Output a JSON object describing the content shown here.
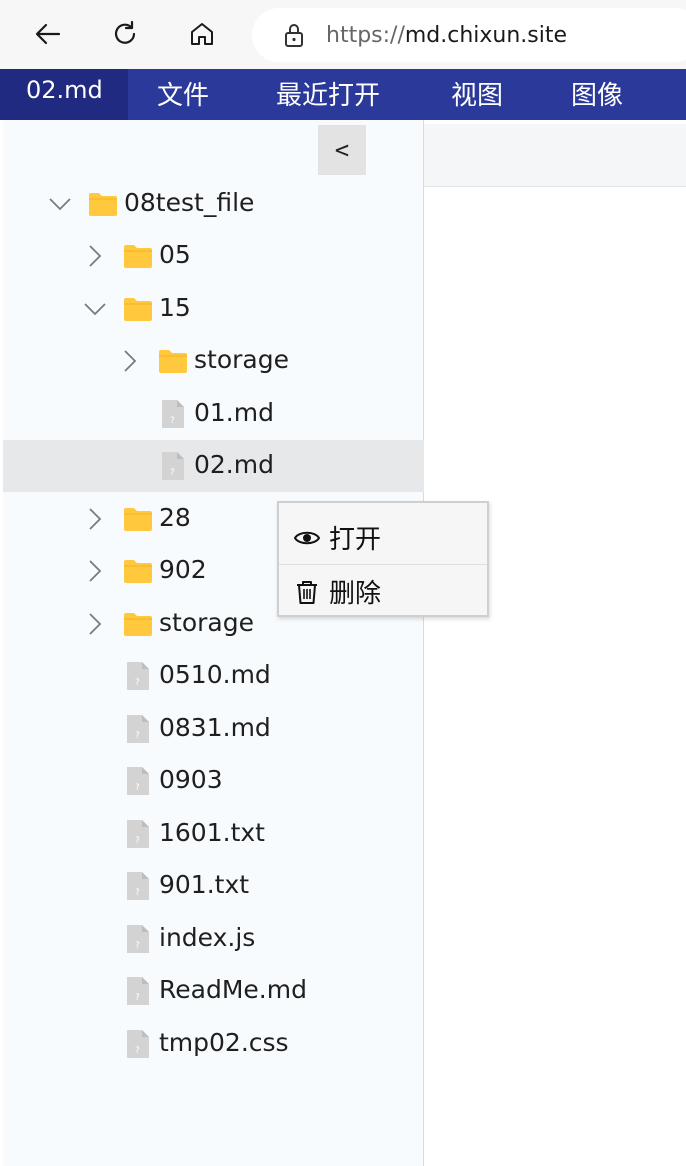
{
  "browser": {
    "url_protocol": "https://",
    "url_host": "md.chixun.site"
  },
  "menubar": {
    "doc_title": "02.md",
    "items": [
      "文件",
      "最近打开",
      "视图",
      "图像"
    ]
  },
  "sidebar": {
    "collapse_label": "<",
    "tree": [
      {
        "name": "08test_file",
        "type": "folder",
        "expanded": true
      },
      {
        "name": "05",
        "type": "folder",
        "expanded": false
      },
      {
        "name": "15",
        "type": "folder",
        "expanded": true
      },
      {
        "name": "storage",
        "type": "folder",
        "expanded": false
      },
      {
        "name": "01.md",
        "type": "file"
      },
      {
        "name": "02.md",
        "type": "file",
        "selected": true
      },
      {
        "name": "28",
        "type": "folder",
        "expanded": false
      },
      {
        "name": "902",
        "type": "folder",
        "expanded": false
      },
      {
        "name": "storage",
        "type": "folder",
        "expanded": false
      },
      {
        "name": "0510.md",
        "type": "file"
      },
      {
        "name": "0831.md",
        "type": "file"
      },
      {
        "name": "0903",
        "type": "file"
      },
      {
        "name": "1601.txt",
        "type": "file"
      },
      {
        "name": "901.txt",
        "type": "file"
      },
      {
        "name": "index.js",
        "type": "file"
      },
      {
        "name": "ReadMe.md",
        "type": "file"
      },
      {
        "name": "tmp02.css",
        "type": "file"
      }
    ]
  },
  "context_menu": {
    "open_label": "打开",
    "delete_label": "删除"
  },
  "colors": {
    "menubar_bg": "#2b3a9a",
    "doc_tab_bg": "#1f2a80",
    "folder": "#ffc83d",
    "selected_row": "#e6e8ea"
  }
}
